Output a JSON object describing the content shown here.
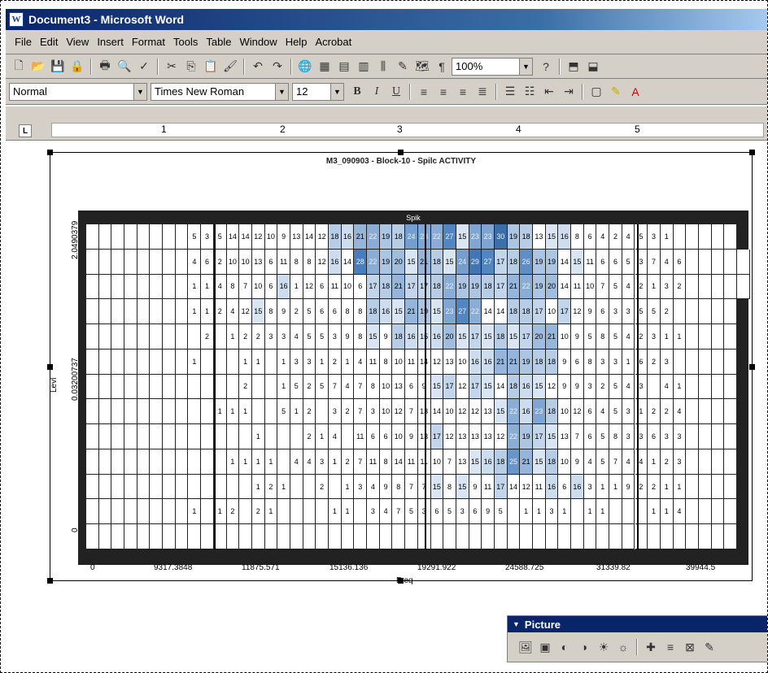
{
  "window": {
    "title": "Document3 - Microsoft Word",
    "app_icon_letter": "W"
  },
  "menu": [
    {
      "label": "File"
    },
    {
      "label": "Edit"
    },
    {
      "label": "View"
    },
    {
      "label": "Insert"
    },
    {
      "label": "Format"
    },
    {
      "label": "Tools"
    },
    {
      "label": "Table"
    },
    {
      "label": "Window"
    },
    {
      "label": "Help"
    },
    {
      "label": "Acrobat"
    }
  ],
  "toolbar_standard": {
    "zoom": "100%"
  },
  "toolbar_formatting": {
    "style": "Normal",
    "font": "Times New Roman",
    "size": "12",
    "bold": "B",
    "italic": "I",
    "underline": "U"
  },
  "ruler": {
    "numbers": [
      "1",
      "2",
      "3",
      "4",
      "5"
    ]
  },
  "chart_data": {
    "type": "heatmap",
    "title": "M3_090903 - Block-10 - Spilc ACTIVITY",
    "panel_label": "Spik",
    "xlabel": "Freq",
    "ylabel": "Levl",
    "x_tick_labels": [
      "0",
      "9317.3848",
      "11875.571",
      "15136.136",
      "19291.922",
      "24588.725",
      "31339.82",
      "39944.5"
    ],
    "y_tick_labels": [
      "2.0490379",
      "0.03200737",
      "0"
    ],
    "rows": [
      [
        "",
        "",
        "",
        "",
        "",
        "",
        "",
        "",
        "5",
        "3",
        "5",
        "14",
        "14",
        "12",
        "10",
        "9",
        "13",
        "14",
        "12",
        "18",
        "16",
        "21",
        "22",
        "19",
        "18",
        "24",
        "23",
        "22",
        "27",
        "15",
        "23",
        "23",
        "30",
        "19",
        "18",
        "13",
        "15",
        "16",
        "8",
        "6",
        "4",
        "2",
        "4",
        "5",
        "3",
        "1",
        "",
        "",
        "",
        "",
        ""
      ],
      [
        "",
        "",
        "",
        "",
        "",
        "",
        "",
        "",
        "4",
        "6",
        "2",
        "10",
        "10",
        "13",
        "6",
        "11",
        "8",
        "8",
        "12",
        "16",
        "14",
        "28",
        "22",
        "19",
        "20",
        "15",
        "21",
        "18",
        "15",
        "24",
        "29",
        "27",
        "17",
        "18",
        "26",
        "19",
        "19",
        "14",
        "15",
        "11",
        "6",
        "6",
        "5",
        "3",
        "7",
        "4",
        "6",
        "",
        "",
        "",
        "",
        ""
      ],
      [
        "",
        "",
        "",
        "",
        "",
        "",
        "",
        "",
        "1",
        "1",
        "4",
        "8",
        "7",
        "10",
        "6",
        "16",
        "1",
        "12",
        "6",
        "11",
        "10",
        "6",
        "17",
        "18",
        "21",
        "17",
        "17",
        "18",
        "22",
        "19",
        "19",
        "18",
        "17",
        "21",
        "22",
        "19",
        "20",
        "14",
        "11",
        "10",
        "7",
        "5",
        "4",
        "2",
        "1",
        "3",
        "2",
        "",
        "",
        "",
        "",
        ""
      ],
      [
        "",
        "",
        "",
        "",
        "",
        "",
        "",
        "",
        "1",
        "1",
        "2",
        "4",
        "12",
        "15",
        "8",
        "9",
        "2",
        "5",
        "6",
        "6",
        "8",
        "8",
        "18",
        "16",
        "15",
        "21",
        "19",
        "15",
        "23",
        "27",
        "22",
        "14",
        "14",
        "18",
        "18",
        "17",
        "10",
        "17",
        "12",
        "9",
        "6",
        "3",
        "3",
        "5",
        "5",
        "2",
        "",
        "",
        "",
        "",
        ""
      ],
      [
        "",
        "",
        "",
        "",
        "",
        "",
        "",
        "",
        "",
        "2",
        "",
        "1",
        "2",
        "2",
        "3",
        "3",
        "4",
        "5",
        "5",
        "3",
        "9",
        "8",
        "15",
        "9",
        "18",
        "16",
        "15",
        "16",
        "20",
        "15",
        "17",
        "15",
        "18",
        "15",
        "17",
        "20",
        "21",
        "10",
        "9",
        "5",
        "8",
        "5",
        "4",
        "2",
        "3",
        "1",
        "1",
        "",
        "",
        "",
        ""
      ],
      [
        "",
        "",
        "",
        "",
        "",
        "",
        "",
        "",
        "1",
        "",
        "",
        "",
        "1",
        "1",
        "",
        "1",
        "3",
        "3",
        "1",
        "2",
        "1",
        "4",
        "11",
        "8",
        "10",
        "11",
        "14",
        "12",
        "13",
        "10",
        "16",
        "16",
        "21",
        "21",
        "19",
        "18",
        "18",
        "9",
        "6",
        "8",
        "3",
        "3",
        "1",
        "6",
        "2",
        "3",
        "",
        "",
        "",
        "",
        ""
      ],
      [
        "",
        "",
        "",
        "",
        "",
        "",
        "",
        "",
        "",
        "",
        "",
        "",
        "2",
        "",
        "",
        "1",
        "5",
        "2",
        "5",
        "7",
        "4",
        "7",
        "8",
        "10",
        "13",
        "6",
        "9",
        "15",
        "17",
        "12",
        "17",
        "15",
        "14",
        "18",
        "16",
        "15",
        "12",
        "9",
        "9",
        "3",
        "2",
        "5",
        "4",
        "3",
        "",
        "4",
        "1",
        "",
        "",
        "",
        ""
      ],
      [
        "",
        "",
        "",
        "",
        "",
        "",
        "",
        "",
        "",
        "",
        "1",
        "1",
        "1",
        "",
        "",
        "5",
        "1",
        "2",
        "",
        "3",
        "2",
        "7",
        "3",
        "10",
        "12",
        "7",
        "13",
        "14",
        "10",
        "12",
        "12",
        "13",
        "15",
        "22",
        "16",
        "23",
        "18",
        "10",
        "12",
        "6",
        "4",
        "5",
        "3",
        "1",
        "2",
        "2",
        "4",
        "",
        "",
        "",
        ""
      ],
      [
        "",
        "",
        "",
        "",
        "",
        "",
        "",
        "",
        "",
        "",
        "",
        "",
        "",
        "1",
        "",
        "",
        "",
        "2",
        "1",
        "4",
        "",
        "11",
        "6",
        "6",
        "10",
        "9",
        "13",
        "17",
        "12",
        "13",
        "13",
        "13",
        "12",
        "22",
        "19",
        "17",
        "15",
        "13",
        "7",
        "6",
        "5",
        "8",
        "3",
        "3",
        "6",
        "3",
        "3",
        "",
        "",
        "",
        ""
      ],
      [
        "",
        "",
        "",
        "",
        "",
        "",
        "",
        "",
        "",
        "",
        "",
        "1",
        "1",
        "1",
        "1",
        "",
        "4",
        "4",
        "3",
        "1",
        "2",
        "7",
        "11",
        "8",
        "14",
        "11",
        "11",
        "10",
        "7",
        "13",
        "15",
        "16",
        "18",
        "25",
        "21",
        "15",
        "18",
        "10",
        "9",
        "4",
        "5",
        "7",
        "4",
        "4",
        "1",
        "2",
        "3",
        "",
        "",
        "",
        ""
      ],
      [
        "",
        "",
        "",
        "",
        "",
        "",
        "",
        "",
        "",
        "",
        "",
        "",
        "",
        "1",
        "2",
        "1",
        "",
        "",
        "2",
        "",
        "1",
        "3",
        "4",
        "9",
        "8",
        "7",
        "7",
        "15",
        "8",
        "15",
        "9",
        "11",
        "17",
        "14",
        "12",
        "11",
        "16",
        "6",
        "16",
        "3",
        "1",
        "1",
        "9",
        "2",
        "2",
        "1",
        "1",
        "",
        "",
        "",
        ""
      ],
      [
        "",
        "",
        "",
        "",
        "",
        "",
        "",
        "",
        "1",
        "",
        "1",
        "2",
        "",
        "2",
        "1",
        "",
        "",
        "",
        "",
        "1",
        "1",
        "",
        "3",
        "4",
        "7",
        "5",
        "3",
        "6",
        "5",
        "3",
        "6",
        "9",
        "5",
        "",
        "1",
        "1",
        "3",
        "1",
        "",
        "1",
        "1",
        "",
        "",
        "",
        "1",
        "1",
        "4",
        "",
        "",
        "",
        ""
      ],
      [
        "",
        "",
        "",
        "",
        "",
        "",
        "",
        "",
        "",
        "",
        "",
        "",
        "",
        "",
        "",
        "",
        "",
        "",
        "",
        "",
        "",
        "",
        "",
        "",
        "",
        "",
        "",
        "",
        "",
        "",
        "",
        "",
        "",
        "",
        "",
        "",
        "",
        "",
        "",
        "",
        "",
        "",
        "",
        "",
        "",
        "",
        "",
        "",
        "",
        "",
        ""
      ]
    ]
  },
  "picture_toolbar": {
    "title": "Picture"
  }
}
